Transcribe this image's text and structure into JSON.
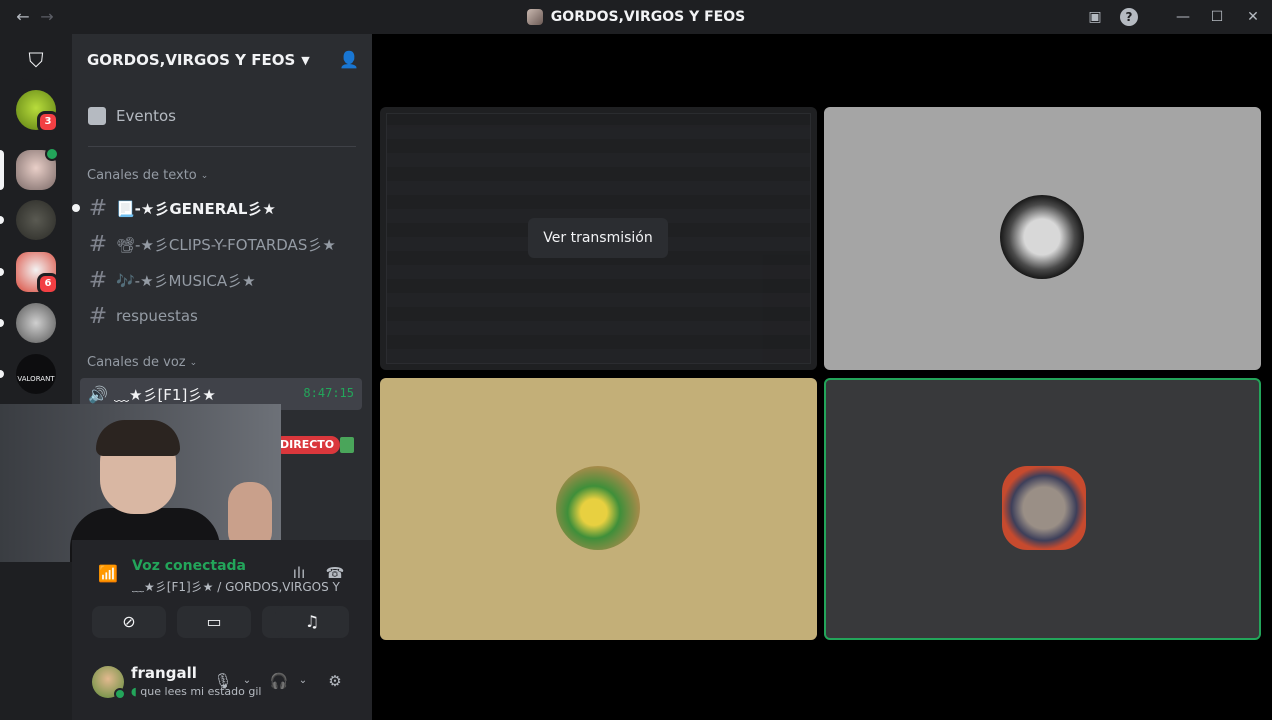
{
  "window": {
    "title": "GORDOS,VIRGOS Y FEOS"
  },
  "rail": {
    "servers": [
      {
        "name": "server-slot-1",
        "badge": "3"
      },
      {
        "name": "server-slot-2",
        "badge": ""
      },
      {
        "name": "server-slot-3",
        "badge": ""
      },
      {
        "name": "server-slot-4",
        "badge": "6"
      },
      {
        "name": "server-slot-5",
        "badge": ""
      },
      {
        "name": "server-slot-6",
        "badge": ""
      }
    ],
    "valorant_label": "VALORANT"
  },
  "sidebar": {
    "server_name": "GORDOS,VIRGOS Y FEOS",
    "events_label": "Eventos",
    "text_category": "Canales de texto",
    "text_channels": [
      "📃-★彡GENERAL彡★",
      "📽-★彡CLIPS-Y-FOTARDAS彡★",
      "🎶-★彡MUSICA彡★",
      "respuestas"
    ],
    "voice_category": "Canales de voz",
    "voice_channel": {
      "name": "﹏★彡[F1]彡★",
      "time": "8:47:15"
    },
    "live_label": "DIRECTO"
  },
  "voice_panel": {
    "status": "Voz conectada",
    "subtitle": "﹏★彡[F1]彡★ / GORDOS,VIRGOS Y FE..."
  },
  "user": {
    "name": "frangall",
    "status": "que lees mi estado gil"
  },
  "stage": {
    "watch_label": "Ver transmisión"
  },
  "colors": {
    "accent_green": "#23a55a",
    "live_red": "#da373c",
    "rail_bg": "#1e1f22",
    "sidebar_bg": "#2b2d31"
  }
}
